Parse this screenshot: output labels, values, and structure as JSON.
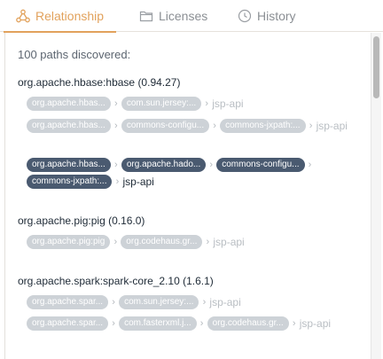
{
  "tabs": [
    {
      "label": "Relationship",
      "icon": "relationship-icon",
      "active": true
    },
    {
      "label": "Licenses",
      "icon": "licenses-icon",
      "active": false
    },
    {
      "label": "History",
      "icon": "history-icon",
      "active": false
    }
  ],
  "summary": "100 paths discovered:",
  "groups": [
    {
      "title": "org.apache.hbase:hbase (0.94.27)",
      "paths": [
        {
          "highlight": false,
          "nodes": [
            "org.apache.hbas...",
            "com.sun.jersey:..."
          ],
          "leaf": "jsp-api"
        },
        {
          "highlight": false,
          "nodes": [
            "org.apache.hbas...",
            "commons-configu...",
            "commons-jxpath:..."
          ],
          "leaf": "jsp-api"
        },
        {
          "highlight": true,
          "nodes": [
            "org.apache.hbas...",
            "org.apache.hado...",
            "commons-configu...",
            "commons-jxpath:..."
          ],
          "leaf": "jsp-api"
        }
      ]
    },
    {
      "title": "org.apache.pig:pig (0.16.0)",
      "paths": [
        {
          "highlight": false,
          "nodes": [
            "org.apache.pig:pig",
            "org.codehaus.gr..."
          ],
          "leaf": "jsp-api"
        }
      ]
    },
    {
      "title": "org.apache.spark:spark-core_2.10 (1.6.1)",
      "paths": [
        {
          "highlight": false,
          "nodes": [
            "org.apache.spar...",
            "com.sun.jersey:..."
          ],
          "leaf": "jsp-api"
        },
        {
          "highlight": false,
          "nodes": [
            "org.apache.spar...",
            "com.fasterxml.j...",
            "org.codehaus.gr..."
          ],
          "leaf": "jsp-api"
        }
      ]
    }
  ],
  "colors": {
    "accent": "#e2a25c",
    "pill_muted": "#cdd2d7",
    "pill_highlight": "#4a5a70",
    "text": "#1e2a36"
  }
}
